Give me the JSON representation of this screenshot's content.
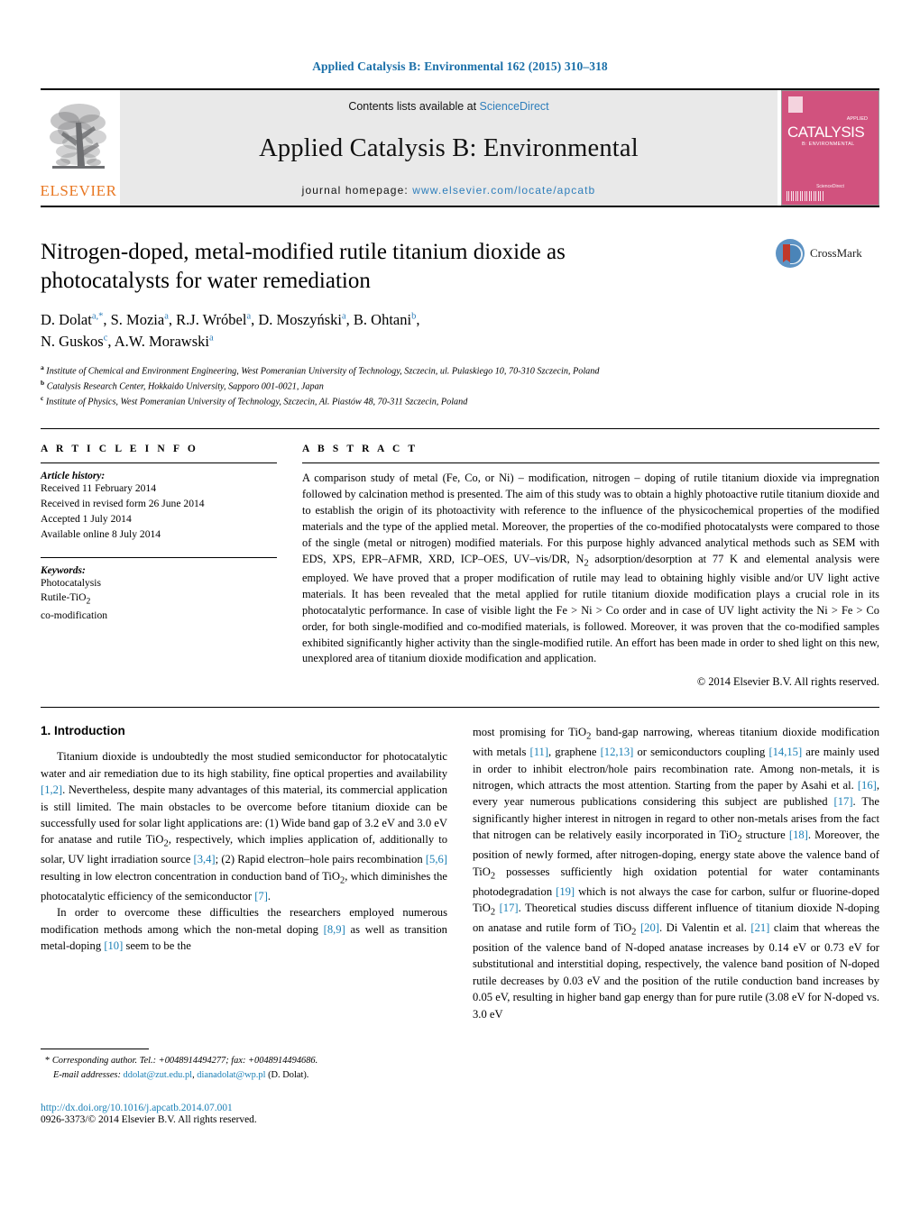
{
  "running_head": "Applied Catalysis B: Environmental 162 (2015) 310–318",
  "masthead": {
    "elsevier_wordmark": "ELSEVIER",
    "contents_prefix": "Contents lists available at ",
    "contents_link": "ScienceDirect",
    "journal_name": "Applied Catalysis B: Environmental",
    "homepage_prefix": "journal homepage: ",
    "homepage_url": "www.elsevier.com/locate/apcatb",
    "cover": {
      "title": "CATALYSIS",
      "sub": "B: ENVIRONMENTAL",
      "corner": "APPLIED",
      "footer": "Available online at",
      "footer2": "ScienceDirect"
    }
  },
  "article": {
    "title": "Nitrogen-doped, metal-modified rutile titanium dioxide as photocatalysts for water remediation",
    "crossmark_label": "CrossMark",
    "authors_line1": "D. Dolat",
    "authors": [
      {
        "name": "D. Dolat",
        "sup": "a,*"
      },
      {
        "name": "S. Mozia",
        "sup": "a"
      },
      {
        "name": "R.J. Wróbel",
        "sup": "a"
      },
      {
        "name": "D. Moszyński",
        "sup": "a"
      },
      {
        "name": "B. Ohtani",
        "sup": "b"
      },
      {
        "name": "N. Guskos",
        "sup": "c"
      },
      {
        "name": "A.W. Morawski",
        "sup": "a"
      }
    ],
    "affiliations": [
      {
        "sup": "a",
        "text": "Institute of Chemical and Environment Engineering, West Pomeranian University of Technology, Szczecin, ul. Pulaskiego 10, 70-310 Szczecin, Poland"
      },
      {
        "sup": "b",
        "text": "Catalysis Research Center, Hokkaido University, Sapporo 001-0021, Japan"
      },
      {
        "sup": "c",
        "text": "Institute of Physics, West Pomeranian University of Technology, Szczecin, Al. Piastów 48, 70-311 Szczecin, Poland"
      }
    ]
  },
  "article_info": {
    "label": "A R T I C L E    I N F O",
    "history_head": "Article history:",
    "history": [
      "Received 11 February 2014",
      "Received in revised form 26 June 2014",
      "Accepted 1 July 2014",
      "Available online 8 July 2014"
    ],
    "keywords_head": "Keywords:",
    "keywords": [
      "Photocatalysis",
      "Rutile-TiO2",
      "co-modification"
    ]
  },
  "abstract": {
    "label": "A B S T R A C T",
    "text": "A comparison study of metal (Fe, Co, or Ni) – modification, nitrogen – doping of rutile titanium dioxide via impregnation followed by calcination method is presented. The aim of this study was to obtain a highly photoactive rutile titanium dioxide and to establish the origin of its photoactivity with reference to the influence of the physicochemical properties of the modified materials and the type of the applied metal. Moreover, the properties of the co-modified photocatalysts were compared to those of the single (metal or nitrogen) modified materials. For this purpose highly advanced analytical methods such as SEM with EDS, XPS, EPR–AFMR, XRD, ICP–OES, UV–vis/DR, N2 adsorption/desorption at 77 K and elemental analysis were employed. We have proved that a proper modification of rutile may lead to obtaining highly visible and/or UV light active materials. It has been revealed that the metal applied for rutile titanium dioxide modification plays a crucial role in its photocatalytic performance. In case of visible light the Fe > Ni > Co order and in case of UV light activity the Ni > Fe > Co order, for both single-modified and co-modified materials, is followed. Moreover, it was proven that the co-modified samples exhibited significantly higher activity than the single-modified rutile. An effort has been made in order to shed light on this new, unexplored area of titanium dioxide modification and application.",
    "copyright": "© 2014 Elsevier B.V. All rights reserved."
  },
  "introduction": {
    "heading": "1.  Introduction",
    "left_paragraphs": [
      "Titanium dioxide is undoubtedly the most studied semiconductor for photocatalytic water and air remediation due to its high stability, fine optical properties and availability [1,2]. Nevertheless, despite many advantages of this material, its commercial application is still limited. The main obstacles to be overcome before titanium dioxide can be successfully used for solar light applications are: (1) Wide band gap of 3.2 eV and 3.0 eV for anatase and rutile TiO2, respectively, which implies application of, additionally to solar, UV light irradiation source [3,4]; (2) Rapid electron–hole pairs recombination [5,6] resulting in low electron concentration in conduction band of TiO2, which diminishes the photocatalytic efficiency of the semiconductor [7].",
      "In order to overcome these difficulties the researchers employed numerous modification methods among which the non-metal doping [8,9] as well as transition metal-doping [10] seem to be the"
    ],
    "right_paragraphs": [
      "most promising for TiO2 band-gap narrowing, whereas titanium dioxide modification with metals [11], graphene [12,13] or semiconductors coupling [14,15] are mainly used in order to inhibit electron/hole pairs recombination rate. Among non-metals, it is nitrogen, which attracts the most attention. Starting from the paper by Asahi et al. [16], every year numerous publications considering this subject are published [17]. The significantly higher interest in nitrogen in regard to other non-metals arises from the fact that nitrogen can be relatively easily incorporated in TiO2 structure [18]. Moreover, the position of newly formed, after nitrogen-doping, energy state above the valence band of TiO2 possesses sufficiently high oxidation potential for water contaminants photodegradation [19] which is not always the case for carbon, sulfur or fluorine-doped TiO2 [17]. Theoretical studies discuss different influence of titanium dioxide N-doping on anatase and rutile form of TiO2 [20]. Di Valentin et al. [21] claim that whereas the position of the valence band of N-doped anatase increases by 0.14 eV or 0.73 eV for substitutional and interstitial doping, respectively, the valence band position of N-doped rutile decreases by 0.03 eV and the position of the rutile conduction band increases by 0.05 eV, resulting in higher band gap energy than for pure rutile (3.08 eV for N-doped vs. 3.0 eV"
    ]
  },
  "footnote": {
    "marker": "*",
    "corresponding": "Corresponding author. Tel.: +0048914494277; fax: +0048914494686.",
    "email_label": "E-mail addresses:",
    "email1": "ddolat@zut.edu.pl",
    "email_sep": ", ",
    "email2": "dianadolat@wp.pl",
    "email_suffix": " (D. Dolat)."
  },
  "doi_block": {
    "doi": "http://dx.doi.org/10.1016/j.apcatb.2014.07.001",
    "issn": "0926-3373/© 2014 Elsevier B.V. All rights reserved."
  },
  "colors": {
    "link": "#1a7fb5",
    "running_head": "#1a6fa8",
    "elsevier_orange": "#E87722",
    "cover_pink": "#d1527e"
  }
}
